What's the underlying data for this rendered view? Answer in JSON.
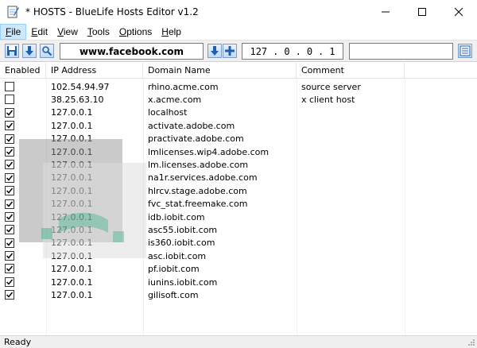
{
  "window": {
    "title": "* HOSTS - BlueLife Hosts Editor v1.2",
    "minimize": "—",
    "maximize": "☐",
    "close": "✕"
  },
  "menu": {
    "items": [
      {
        "label": "File",
        "accel": "F",
        "rest": "ile"
      },
      {
        "label": "Edit",
        "accel": "E",
        "rest": "dit"
      },
      {
        "label": "View",
        "accel": "V",
        "rest": "iew"
      },
      {
        "label": "Tools",
        "accel": "T",
        "rest": "ools"
      },
      {
        "label": "Options",
        "accel": "O",
        "rest": "ptions"
      },
      {
        "label": "Help",
        "accel": "H",
        "rest": "elp"
      }
    ]
  },
  "toolbar": {
    "domain_value": "www.facebook.com",
    "ip_octets": [
      "127",
      "0",
      "0",
      "1"
    ],
    "comment_value": ""
  },
  "columns": {
    "enabled": "Enabled",
    "ip": "IP Address",
    "domain": "Domain Name",
    "comment": "Comment"
  },
  "rows": [
    {
      "enabled": false,
      "ip": "102.54.94.97",
      "domain": "rhino.acme.com",
      "comment": "source server"
    },
    {
      "enabled": false,
      "ip": "38.25.63.10",
      "domain": "x.acme.com",
      "comment": "x client host"
    },
    {
      "enabled": true,
      "ip": "127.0.0.1",
      "domain": "localhost",
      "comment": ""
    },
    {
      "enabled": true,
      "ip": "127.0.0.1",
      "domain": "activate.adobe.com",
      "comment": ""
    },
    {
      "enabled": true,
      "ip": "127.0.0.1",
      "domain": "practivate.adobe.com",
      "comment": ""
    },
    {
      "enabled": true,
      "ip": "127.0.0.1",
      "domain": "lmlicenses.wip4.adobe.com",
      "comment": ""
    },
    {
      "enabled": true,
      "ip": "127.0.0.1",
      "domain": "lm.licenses.adobe.com",
      "comment": ""
    },
    {
      "enabled": true,
      "ip": "127.0.0.1",
      "domain": "na1r.services.adobe.com",
      "comment": ""
    },
    {
      "enabled": true,
      "ip": "127.0.0.1",
      "domain": "hlrcv.stage.adobe.com",
      "comment": ""
    },
    {
      "enabled": true,
      "ip": "127.0.0.1",
      "domain": "fvc_stat.freemake.com",
      "comment": ""
    },
    {
      "enabled": true,
      "ip": "127.0.0.1",
      "domain": "idb.iobit.com",
      "comment": ""
    },
    {
      "enabled": true,
      "ip": "127.0.0.1",
      "domain": "asc55.iobit.com",
      "comment": ""
    },
    {
      "enabled": true,
      "ip": "127.0.0.1",
      "domain": "is360.iobit.com",
      "comment": ""
    },
    {
      "enabled": true,
      "ip": "127.0.0.1",
      "domain": "asc.iobit.com",
      "comment": ""
    },
    {
      "enabled": true,
      "ip": "127.0.0.1",
      "domain": "pf.iobit.com",
      "comment": ""
    },
    {
      "enabled": true,
      "ip": "127.0.0.1",
      "domain": "iunins.iobit.com",
      "comment": ""
    },
    {
      "enabled": true,
      "ip": "127.0.0.1",
      "domain": "gilisoft.com",
      "comment": ""
    }
  ],
  "status": {
    "text": "Ready"
  },
  "colors": {
    "accent": "#0b66c2",
    "menu_active": "#cce8ff",
    "toolbar_bg": "#f0f0f0"
  },
  "icons": [
    "notepad-icon",
    "save-icon",
    "download-icon",
    "search-icon",
    "add-icon",
    "remove-icon",
    "list-icon"
  ]
}
